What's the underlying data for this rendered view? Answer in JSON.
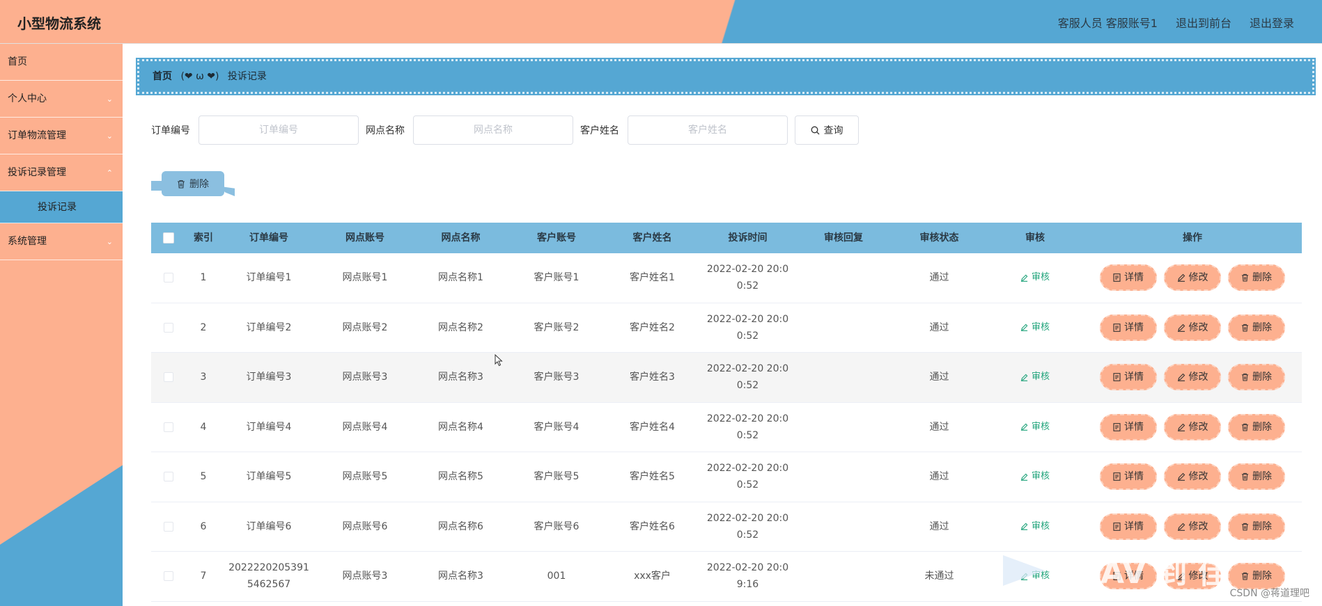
{
  "app": {
    "title": "小型物流系统"
  },
  "header": {
    "user_label": "客服人员 客服账号1",
    "to_front_label": "退出到前台",
    "logout_label": "退出登录"
  },
  "sidebar": {
    "items": [
      {
        "label": "首页",
        "expandable": false
      },
      {
        "label": "个人中心",
        "expandable": true
      },
      {
        "label": "订单物流管理",
        "expandable": true
      },
      {
        "label": "投诉记录管理",
        "expandable": true,
        "expanded": true
      },
      {
        "label": "系统管理",
        "expandable": true
      }
    ],
    "sub_item": {
      "label": "投诉记录",
      "parent": "投诉记录管理",
      "active": true
    }
  },
  "breadcrumb": {
    "home": "首页",
    "separator": "(❤ ω ❤)",
    "current": "投诉记录"
  },
  "search": {
    "order_label": "订单编号",
    "order_placeholder": "订单编号",
    "outlet_label": "网点名称",
    "outlet_placeholder": "网点名称",
    "customer_label": "客户姓名",
    "customer_placeholder": "客户姓名",
    "query_label": "查询"
  },
  "toolbar": {
    "delete_label": "删除"
  },
  "table": {
    "headers": [
      "索引",
      "订单编号",
      "网点账号",
      "网点名称",
      "客户账号",
      "客户姓名",
      "投诉时间",
      "审核回复",
      "审核状态",
      "审核",
      "操作"
    ],
    "audit_label": "审核",
    "detail_label": "详情",
    "edit_label": "修改",
    "delete_label": "删除",
    "rows": [
      {
        "idx": "1",
        "order": "订单编号1",
        "outlet_acc": "网点账号1",
        "outlet_name": "网点名称1",
        "cust_acc": "客户账号1",
        "cust_name": "客户姓名1",
        "time": "2022-02-20 20:00:52",
        "reply": "",
        "status": "通过"
      },
      {
        "idx": "2",
        "order": "订单编号2",
        "outlet_acc": "网点账号2",
        "outlet_name": "网点名称2",
        "cust_acc": "客户账号2",
        "cust_name": "客户姓名2",
        "time": "2022-02-20 20:00:52",
        "reply": "",
        "status": "通过"
      },
      {
        "idx": "3",
        "order": "订单编号3",
        "outlet_acc": "网点账号3",
        "outlet_name": "网点名称3",
        "cust_acc": "客户账号3",
        "cust_name": "客户姓名3",
        "time": "2022-02-20 20:00:52",
        "reply": "",
        "status": "通过"
      },
      {
        "idx": "4",
        "order": "订单编号4",
        "outlet_acc": "网点账号4",
        "outlet_name": "网点名称4",
        "cust_acc": "客户账号4",
        "cust_name": "客户姓名4",
        "time": "2022-02-20 20:00:52",
        "reply": "",
        "status": "通过"
      },
      {
        "idx": "5",
        "order": "订单编号5",
        "outlet_acc": "网点账号5",
        "outlet_name": "网点名称5",
        "cust_acc": "客户账号5",
        "cust_name": "客户姓名5",
        "time": "2022-02-20 20:00:52",
        "reply": "",
        "status": "通过"
      },
      {
        "idx": "6",
        "order": "订单编号6",
        "outlet_acc": "网点账号6",
        "outlet_name": "网点名称6",
        "cust_acc": "客户账号6",
        "cust_name": "客户姓名6",
        "time": "2022-02-20 20:00:52",
        "reply": "",
        "status": "通过"
      },
      {
        "idx": "7",
        "order": "20222202053915462567",
        "outlet_acc": "网点账号3",
        "outlet_name": "网点名称3",
        "cust_acc": "001",
        "cust_name": "xxx客户",
        "time": "2022-02-20 20:09:16",
        "reply": "",
        "status": "未通过"
      }
    ]
  },
  "watermark": {
    "text": "CSDN @蒋道理吧"
  },
  "colors": {
    "peach": "#fdb08f",
    "blue": "#55a7d3",
    "header_row": "#7bbbde",
    "audit_green": "#1fa37a"
  }
}
